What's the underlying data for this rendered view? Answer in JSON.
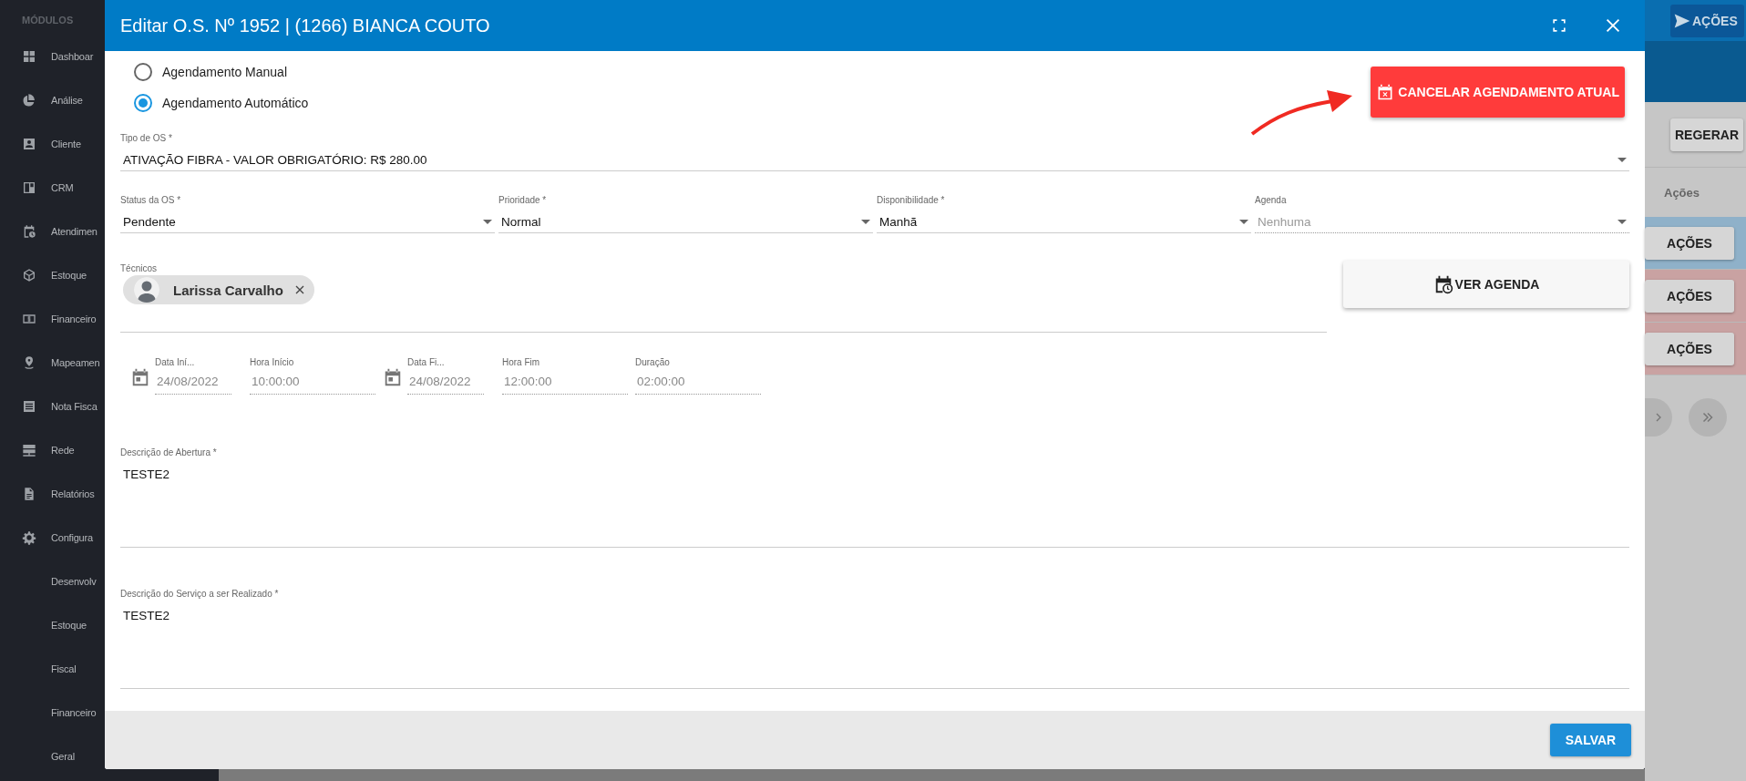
{
  "sidebar": {
    "heading": "MÓDULOS",
    "items": [
      {
        "label": "Dashboar"
      },
      {
        "label": "Análise"
      },
      {
        "label": "Cliente"
      },
      {
        "label": "CRM"
      },
      {
        "label": "Atendimen"
      },
      {
        "label": "Estoque"
      },
      {
        "label": "Financeiro"
      },
      {
        "label": "Mapeamen"
      },
      {
        "label": "Nota Fisca"
      },
      {
        "label": "Rede"
      },
      {
        "label": "Relatórios"
      },
      {
        "label": "Configura"
      }
    ],
    "sub_items": [
      {
        "label": "Desenvolv"
      },
      {
        "label": "Estoque"
      },
      {
        "label": "Fiscal"
      },
      {
        "label": "Financeiro"
      },
      {
        "label": "Geral"
      }
    ]
  },
  "modal": {
    "title": "Editar O.S. Nº 1952 | (1266) BIANCA COUTO",
    "scheduling_options": [
      {
        "label": "Agendamento Manual",
        "selected": false
      },
      {
        "label": "Agendamento Automático",
        "selected": true
      }
    ],
    "cancel_button": "CANCELAR AGENDAMENTO ATUAL",
    "os_type": {
      "label": "Tipo de OS *",
      "value": "ATIVAÇÃO FIBRA - VALOR OBRIGATÓRIO: R$ 280.00"
    },
    "selects": [
      {
        "label": "Status da OS *",
        "value": "Pendente",
        "disabled": false
      },
      {
        "label": "Prioridade *",
        "value": "Normal",
        "disabled": false
      },
      {
        "label": "Disponibilidade *",
        "value": "Manhã",
        "disabled": false
      },
      {
        "label": "Agenda",
        "value": "Nenhuma",
        "disabled": true
      }
    ],
    "technicians": {
      "label": "Técnicos",
      "chips": [
        {
          "name": "Larissa Carvalho"
        }
      ]
    },
    "schedule_button": "VER AGENDA",
    "time_fields": [
      {
        "kind": "date",
        "label": "Data Iní...",
        "value": "24/08/2022",
        "disabled": true
      },
      {
        "kind": "time",
        "label": "Hora Início",
        "value": "10:00:00",
        "disabled": true
      },
      {
        "kind": "date",
        "label": "Data Fi...",
        "value": "24/08/2022",
        "disabled": true
      },
      {
        "kind": "time",
        "label": "Hora Fim",
        "value": "12:00:00",
        "disabled": true
      },
      {
        "kind": "time",
        "label": "Duração",
        "value": "02:00:00",
        "disabled": true
      }
    ],
    "descriptions": [
      {
        "label": "Descrição de Abertura *",
        "value": "TESTE2"
      },
      {
        "label": "Descrição do Serviço a ser Realizado *",
        "value": "TESTE2"
      }
    ],
    "save_button": "SALVAR"
  },
  "background_page": {
    "actions_button": "AÇÕES",
    "regenerate_button": "REGERAR",
    "column_header": "Ações",
    "rows": [
      {
        "button": "AÇÕES",
        "color": "#8fb1c9"
      },
      {
        "button": "AÇÕES",
        "color": "#c9a2a2"
      },
      {
        "button": "AÇÕES",
        "color": "#c9a2a2"
      }
    ]
  }
}
